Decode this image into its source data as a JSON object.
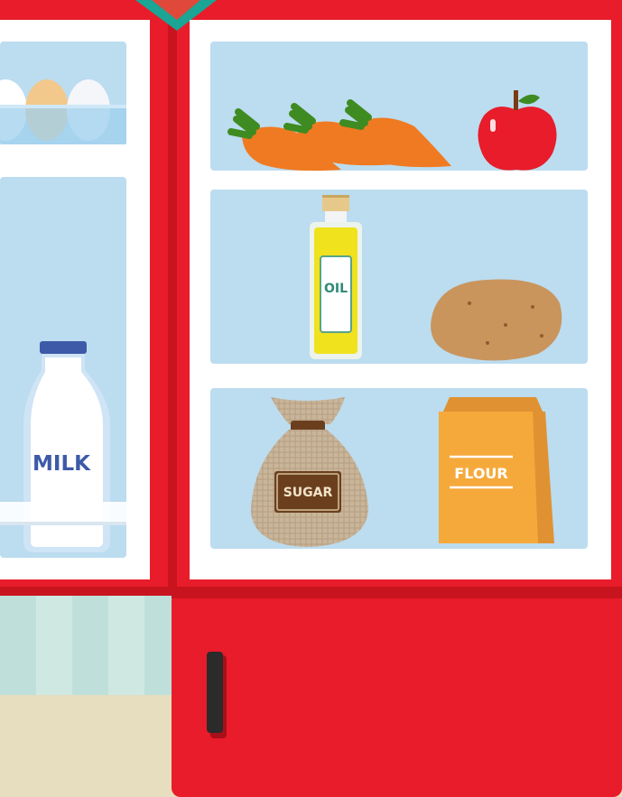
{
  "scene": {
    "fridge_color": "#e81c2a",
    "shelf_color": "#bcdcef"
  },
  "items": {
    "milk_label": "MILK",
    "oil_label": "OIL",
    "sugar_label": "SUGAR",
    "flour_label": "FLOUR"
  }
}
